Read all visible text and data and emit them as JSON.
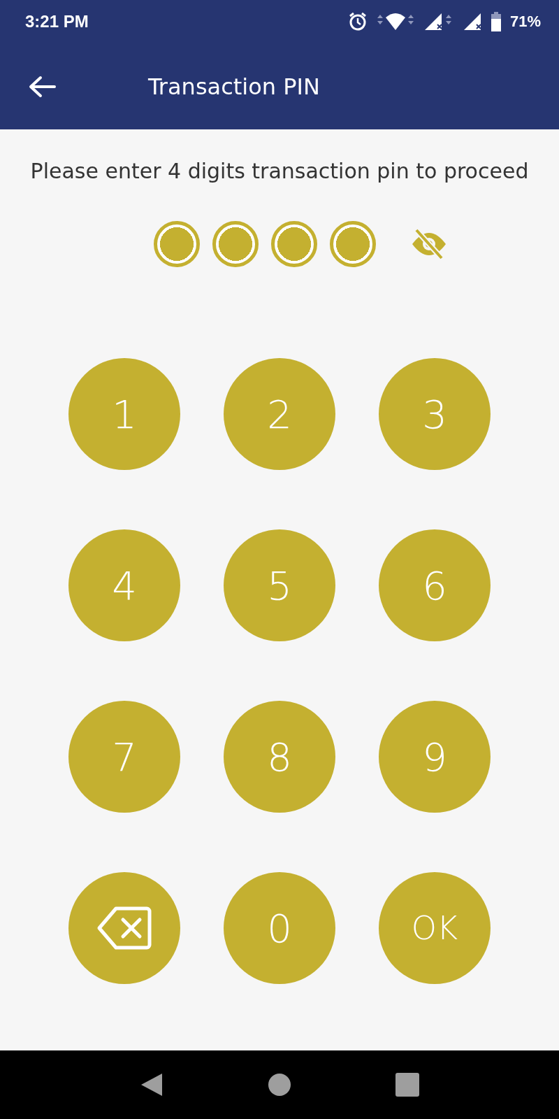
{
  "status_bar": {
    "time": "3:21 PM",
    "battery": "71%"
  },
  "header": {
    "title": "Transaction PIN"
  },
  "prompt": "Please enter 4 digits transaction pin to proceed",
  "pin_dots": [
    {
      "filled": true
    },
    {
      "filled": true
    },
    {
      "filled": true
    },
    {
      "filled": true
    }
  ],
  "keypad": [
    {
      "kind": "digit",
      "label": "1"
    },
    {
      "kind": "digit",
      "label": "2"
    },
    {
      "kind": "digit",
      "label": "3"
    },
    {
      "kind": "digit",
      "label": "4"
    },
    {
      "kind": "digit",
      "label": "5"
    },
    {
      "kind": "digit",
      "label": "6"
    },
    {
      "kind": "digit",
      "label": "7"
    },
    {
      "kind": "digit",
      "label": "8"
    },
    {
      "kind": "digit",
      "label": "9"
    },
    {
      "kind": "backspace"
    },
    {
      "kind": "digit",
      "label": "0"
    },
    {
      "kind": "ok",
      "label": "OK"
    }
  ]
}
